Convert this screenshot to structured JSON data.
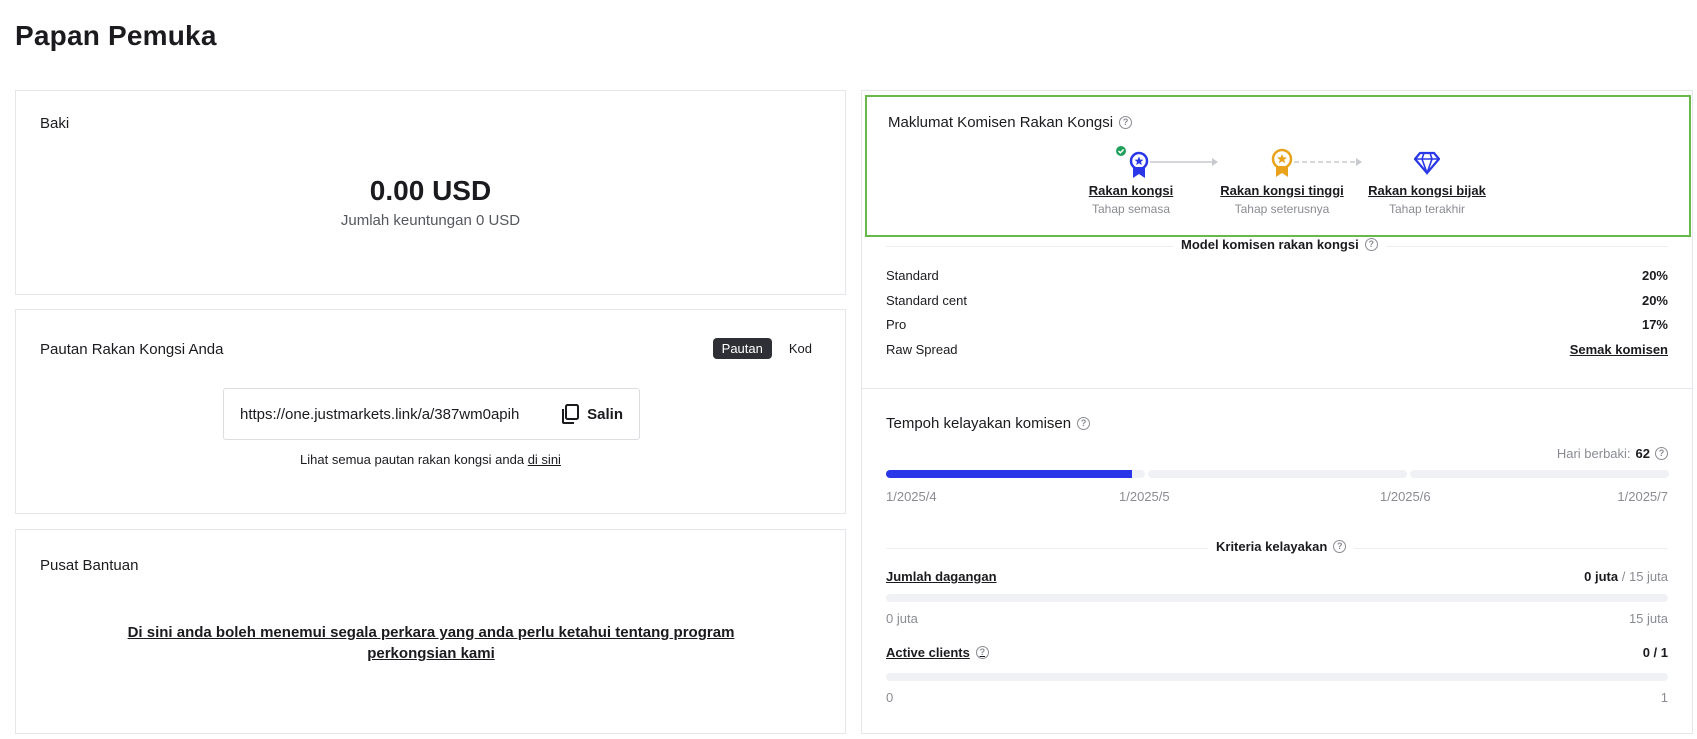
{
  "page": {
    "title": "Papan Pemuka"
  },
  "balance": {
    "title": "Baki",
    "amount": "0.00 USD",
    "subtitle": "Jumlah keuntungan 0 USD"
  },
  "partner_link": {
    "title": "Pautan Rakan Kongsi Anda",
    "tabs": [
      {
        "label": "Pautan",
        "active": true
      },
      {
        "label": "Kod",
        "active": false
      }
    ],
    "url": "https://one.justmarkets.link/a/387wm0apih",
    "copy_label": "Salin",
    "hint_prefix": "Lihat semua pautan rakan kongsi anda ",
    "hint_link": "di sini"
  },
  "help_center": {
    "title": "Pusat Bantuan",
    "link_text": "Di sini anda boleh menemui segala perkara yang anda perlu ketahui tentang program perkongsian kami"
  },
  "commission_info": {
    "title": "Maklumat Komisen Rakan Kongsi",
    "tiers": [
      {
        "name": "Rakan kongsi",
        "stage": "Tahap semasa",
        "icon": "ribbon-medal-icon",
        "color": "#2a37e8",
        "completed": true
      },
      {
        "name": "Rakan kongsi tinggi",
        "stage": "Tahap seterusnya",
        "icon": "gold-medal-icon",
        "color": "#e8a21c"
      },
      {
        "name": "Rakan kongsi bijak",
        "stage": "Tahap terakhir",
        "icon": "diamond-icon",
        "color": "#2a37e8"
      }
    ]
  },
  "commission_model": {
    "title": "Model komisen rakan kongsi",
    "rows": [
      {
        "label": "Standard",
        "value": "20%"
      },
      {
        "label": "Standard cent",
        "value": "20%"
      },
      {
        "label": "Pro",
        "value": "17%"
      },
      {
        "label": "Raw Spread",
        "value": "Semak komisen",
        "is_link": true
      }
    ]
  },
  "eligibility_period": {
    "title": "Tempoh kelayakan komisen",
    "days_left_label": "Hari berbaki:",
    "days_left": "62",
    "months": [
      "1/2025/4",
      "1/2025/5",
      "1/2025/6",
      "1/2025/7"
    ],
    "segment_progress": [
      0.95,
      0,
      0
    ]
  },
  "criteria": {
    "title": "Kriteria kelayakan",
    "items": [
      {
        "label": "Jumlah dagangan",
        "current": "0 juta",
        "total": " / 15 juta",
        "min": "0 juta",
        "max": "15 juta",
        "progress": 0,
        "has_help": false
      },
      {
        "label": "Active clients",
        "current": "0 / 1",
        "total": "",
        "min": "0",
        "max": "1",
        "progress": 0,
        "has_help": true
      }
    ]
  },
  "colors": {
    "accent": "#2a37e8",
    "highlight_border": "#6ab84a",
    "gold": "#e8a21c",
    "success": "#1fa05a"
  }
}
